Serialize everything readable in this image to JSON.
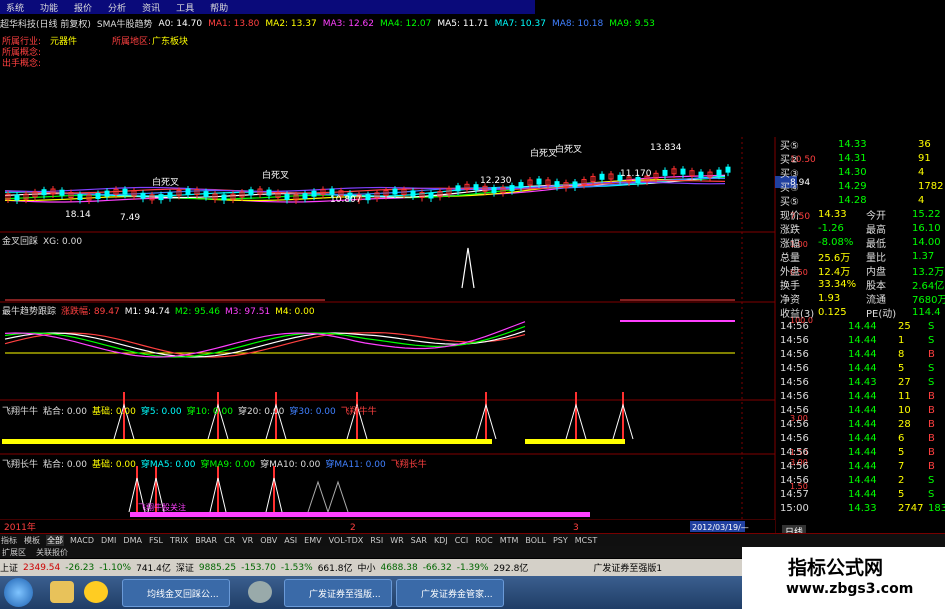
{
  "menu": [
    "系统",
    "功能",
    "报价",
    "分析",
    "资讯",
    "工具",
    "帮助"
  ],
  "header": {
    "title": "超华科技(日线 前复权)",
    "indicator": "SMA牛股趋势",
    "items": [
      {
        "label": "A0: 14.70",
        "color": "#ffffff"
      },
      {
        "label": "MA1: 13.80",
        "color": "#ff4040"
      },
      {
        "label": "MA2: 13.37",
        "color": "#ffff00"
      },
      {
        "label": "MA3: 12.62",
        "color": "#ff40ff"
      },
      {
        "label": "MA4: 12.07",
        "color": "#00ff00"
      },
      {
        "label": "MA5: 11.71",
        "color": "#ffffff"
      },
      {
        "label": "MA7: 10.37",
        "color": "#00ffff"
      },
      {
        "label": "MA8: 10.18",
        "color": "#4080ff"
      },
      {
        "label": "MA9: 9.53",
        "color": "#00ff00"
      }
    ]
  },
  "info_rows": [
    [
      {
        "t": "所属行业:",
        "c": "#ff4040"
      },
      {
        "t": "元器件",
        "c": "#ffff00"
      },
      {
        "t": "所属地区:",
        "c": "#ff4040"
      },
      {
        "t": "广东板块",
        "c": "#ffff00"
      }
    ],
    [
      {
        "t": "所属概念:",
        "c": "#ff4040"
      }
    ],
    [
      {
        "t": "出手概念:",
        "c": "#ff4040"
      }
    ]
  ],
  "price_annotations": [
    "白死叉",
    "白死叉",
    "白死叉",
    "白死叉",
    "18.14",
    "7.49",
    "10.807",
    "11.170",
    "12.230",
    "13.834"
  ],
  "price_axis": [
    "10.50",
    "8.94",
    "7.50"
  ],
  "panels": [
    {
      "name": "golden-cross-panel",
      "labels": [
        {
          "t": "金叉回踩",
          "c": "#dddddd"
        },
        {
          "t": "XG: 0.00",
          "c": "#dddddd"
        }
      ],
      "axis": [
        "1.00",
        "0.50"
      ]
    },
    {
      "name": "bull-trend-panel",
      "labels": [
        {
          "t": "最牛趋势跟踪",
          "c": "#dddddd"
        },
        {
          "t": "涨跌幅: 89.47",
          "c": "#ff4040"
        },
        {
          "t": "M1: 94.74",
          "c": "#ffffff"
        },
        {
          "t": "M2: 95.46",
          "c": "#00ff00"
        },
        {
          "t": "M3: 97.51",
          "c": "#ff40ff"
        },
        {
          "t": "M4: 0.00",
          "c": "#ffff00"
        }
      ],
      "axis": [
        "100.0"
      ]
    },
    {
      "name": "fly-bull-panel-1",
      "labels": [
        {
          "t": "飞翔牛牛",
          "c": "#dddddd"
        },
        {
          "t": "粘合: 0.00",
          "c": "#dddddd"
        },
        {
          "t": "基础: 0.00",
          "c": "#ffff00"
        },
        {
          "t": "穿5: 0.00",
          "c": "#00ffff"
        },
        {
          "t": "穿10: 0.00",
          "c": "#00ff00"
        },
        {
          "t": "穿20: 0.00",
          "c": "#dddddd"
        },
        {
          "t": "穿30: 0.00",
          "c": "#4080ff"
        },
        {
          "t": "飞翔牛牛",
          "c": "#ff4040"
        }
      ],
      "axis": [
        "3.00",
        "1.50"
      ]
    },
    {
      "name": "fly-bull-panel-2",
      "labels": [
        {
          "t": "飞翔长牛",
          "c": "#dddddd"
        },
        {
          "t": "粘合: 0.00",
          "c": "#dddddd"
        },
        {
          "t": "基础: 0.00",
          "c": "#ffff00"
        },
        {
          "t": "穿MA5: 0.00",
          "c": "#00ffff"
        },
        {
          "t": "穿MA9: 0.00",
          "c": "#00ff00"
        },
        {
          "t": "穿MA10: 0.00",
          "c": "#dddddd"
        },
        {
          "t": "穿MA11: 0.00",
          "c": "#4080ff"
        },
        {
          "t": "飞翔长牛",
          "c": "#ff4040"
        }
      ],
      "axis": [
        "3.00",
        "1.50"
      ],
      "note": "飞翔牛股关注"
    }
  ],
  "time_axis": {
    "left": "2011年",
    "m1": "2",
    "m2": "3",
    "date": "2012/03/19/—"
  },
  "quotes": {
    "top": [
      {
        "k": "买⑤",
        "v": "14.33",
        "n": "36"
      },
      {
        "k": "买②",
        "v": "14.31",
        "n": "91"
      },
      {
        "k": "买③",
        "v": "14.30",
        "n": "4"
      },
      {
        "k": "买④",
        "v": "14.29",
        "n": "1782"
      },
      {
        "k": "买⑤",
        "v": "14.28",
        "n": "4"
      }
    ],
    "stats": [
      {
        "a": "现价",
        "b": "14.33",
        "c": "今开",
        "d": "15.22"
      },
      {
        "a": "涨跌",
        "b": "-1.26",
        "c": "最高",
        "d": "16.10"
      },
      {
        "a": "涨幅",
        "b": "-8.08%",
        "c": "最低",
        "d": "14.00"
      },
      {
        "a": "总量",
        "b": "25.6万",
        "c": "量比",
        "d": "1.37"
      },
      {
        "a": "外盘",
        "b": "12.4万",
        "c": "内盘",
        "d": "13.2万"
      },
      {
        "a": "换手",
        "b": "33.34%",
        "c": "股本",
        "d": "2.64亿"
      },
      {
        "a": "净资",
        "b": "1.93",
        "c": "流通",
        "d": "7680万"
      },
      {
        "a": "收益(3)",
        "b": "0.125",
        "c": "PE(动)",
        "d": "114.4"
      }
    ],
    "ticks": [
      {
        "t": "14:56",
        "p": "14.44",
        "v": "25",
        "s": "S"
      },
      {
        "t": "14:56",
        "p": "14.44",
        "v": "1",
        "s": "S"
      },
      {
        "t": "14:56",
        "p": "14.44",
        "v": "8",
        "s": "B"
      },
      {
        "t": "14:56",
        "p": "14.44",
        "v": "5",
        "s": "S"
      },
      {
        "t": "14:56",
        "p": "14.43",
        "v": "27",
        "s": "S"
      },
      {
        "t": "14:56",
        "p": "14.44",
        "v": "11",
        "s": "B"
      },
      {
        "t": "14:56",
        "p": "14.44",
        "v": "10",
        "s": "B"
      },
      {
        "t": "14:56",
        "p": "14.44",
        "v": "28",
        "s": "B"
      },
      {
        "t": "14:56",
        "p": "14.44",
        "v": "6",
        "s": "B"
      },
      {
        "t": "14:56",
        "p": "14.44",
        "v": "5",
        "s": "B"
      },
      {
        "t": "14:56",
        "p": "14.44",
        "v": "7",
        "s": "B"
      },
      {
        "t": "14:56",
        "p": "14.44",
        "v": "2",
        "s": "S"
      },
      {
        "t": "14:57",
        "p": "14.44",
        "v": "5",
        "s": "S"
      },
      {
        "t": "15:00",
        "p": "14.33",
        "v": "2747",
        "s": "183"
      }
    ],
    "tab": "日线"
  },
  "tabs": [
    "指标",
    "模板",
    "全部",
    "MACD",
    "DMI",
    "DMA",
    "FSL",
    "TRIX",
    "BRAR",
    "CR",
    "VR",
    "OBV",
    "ASI",
    "EMV",
    "VOL-TDX",
    "RSI",
    "WR",
    "SAR",
    "KDJ",
    "CCI",
    "ROC",
    "MTM",
    "BOLL",
    "PSY",
    "MCST"
  ],
  "active_tab": "全部",
  "subtabs": [
    "扩展区",
    "关联报价"
  ],
  "ticker": [
    {
      "t": "上证",
      "c": "#000000"
    },
    {
      "t": "2349.54",
      "c": "#cc0000"
    },
    {
      "t": "-26.23",
      "c": "#006600"
    },
    {
      "t": "-1.10%",
      "c": "#006600"
    },
    {
      "t": "741.4亿",
      "c": "#000000"
    },
    {
      "t": "深证",
      "c": "#000000"
    },
    {
      "t": "9885.25",
      "c": "#006600"
    },
    {
      "t": "-153.70",
      "c": "#006600"
    },
    {
      "t": "-1.53%",
      "c": "#006600"
    },
    {
      "t": "661.8亿",
      "c": "#000000"
    },
    {
      "t": "中小",
      "c": "#000000"
    },
    {
      "t": "4688.38",
      "c": "#006600"
    },
    {
      "t": "-66.32",
      "c": "#006600"
    },
    {
      "t": "-1.39%",
      "c": "#006600"
    },
    {
      "t": "292.8亿",
      "c": "#000000"
    },
    {
      "t": "广发证券至强版1",
      "c": "#000000"
    }
  ],
  "taskbar": [
    "均线金叉回踩公...",
    "广发证券至强版...",
    "广发证券金管家..."
  ],
  "watermark": {
    "t1": "指标公式网",
    "t2": "www.zbgs3.com"
  },
  "colors": {
    "up": "#ff3030",
    "down": "#00ff00",
    "yellow": "#ffff00",
    "grid": "#800000"
  }
}
